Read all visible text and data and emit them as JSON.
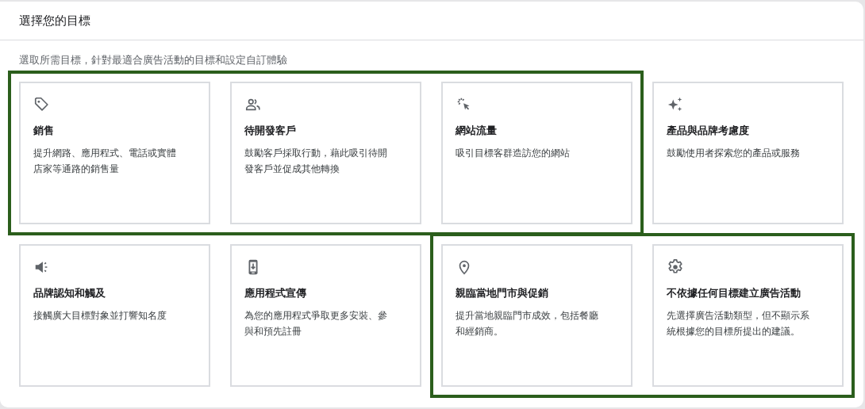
{
  "panel": {
    "title": "選擇您的目標",
    "subtitle": "選取所需目標，針對最適合廣告活動的目標和設定自訂體驗"
  },
  "cards": [
    {
      "title": "銷售",
      "description": "提升網路、應用程式、電話或實體店家等通路的銷售量",
      "outlined": true
    },
    {
      "title": "待開發客戶",
      "description": "鼓勵客戶採取行動，藉此吸引待開發客戶並促成其他轉換",
      "outlined": true
    },
    {
      "title": "網站流量",
      "description": "吸引目標客群造訪您的網站",
      "outlined": true
    },
    {
      "title": "產品與品牌考慮度",
      "description": "鼓勵使用者探索您的產品或服務",
      "outlined": false
    },
    {
      "title": "品牌認知和觸及",
      "description": "接觸廣大目標對象並打響知名度",
      "outlined": false
    },
    {
      "title": "應用程式宣傳",
      "description": "為您的應用程式爭取更多安裝、參與和預先註冊",
      "outlined": false
    },
    {
      "title": "親臨當地門市與促銷",
      "description": "提升當地親臨門市成效，包括餐廳和經銷商。",
      "outlined": true
    },
    {
      "title": "不依據任何目標建立廣告活動",
      "description": "先選擇廣告活動類型，但不顯示系統根據您的目標所提出的建議。",
      "outlined": true
    }
  ]
}
